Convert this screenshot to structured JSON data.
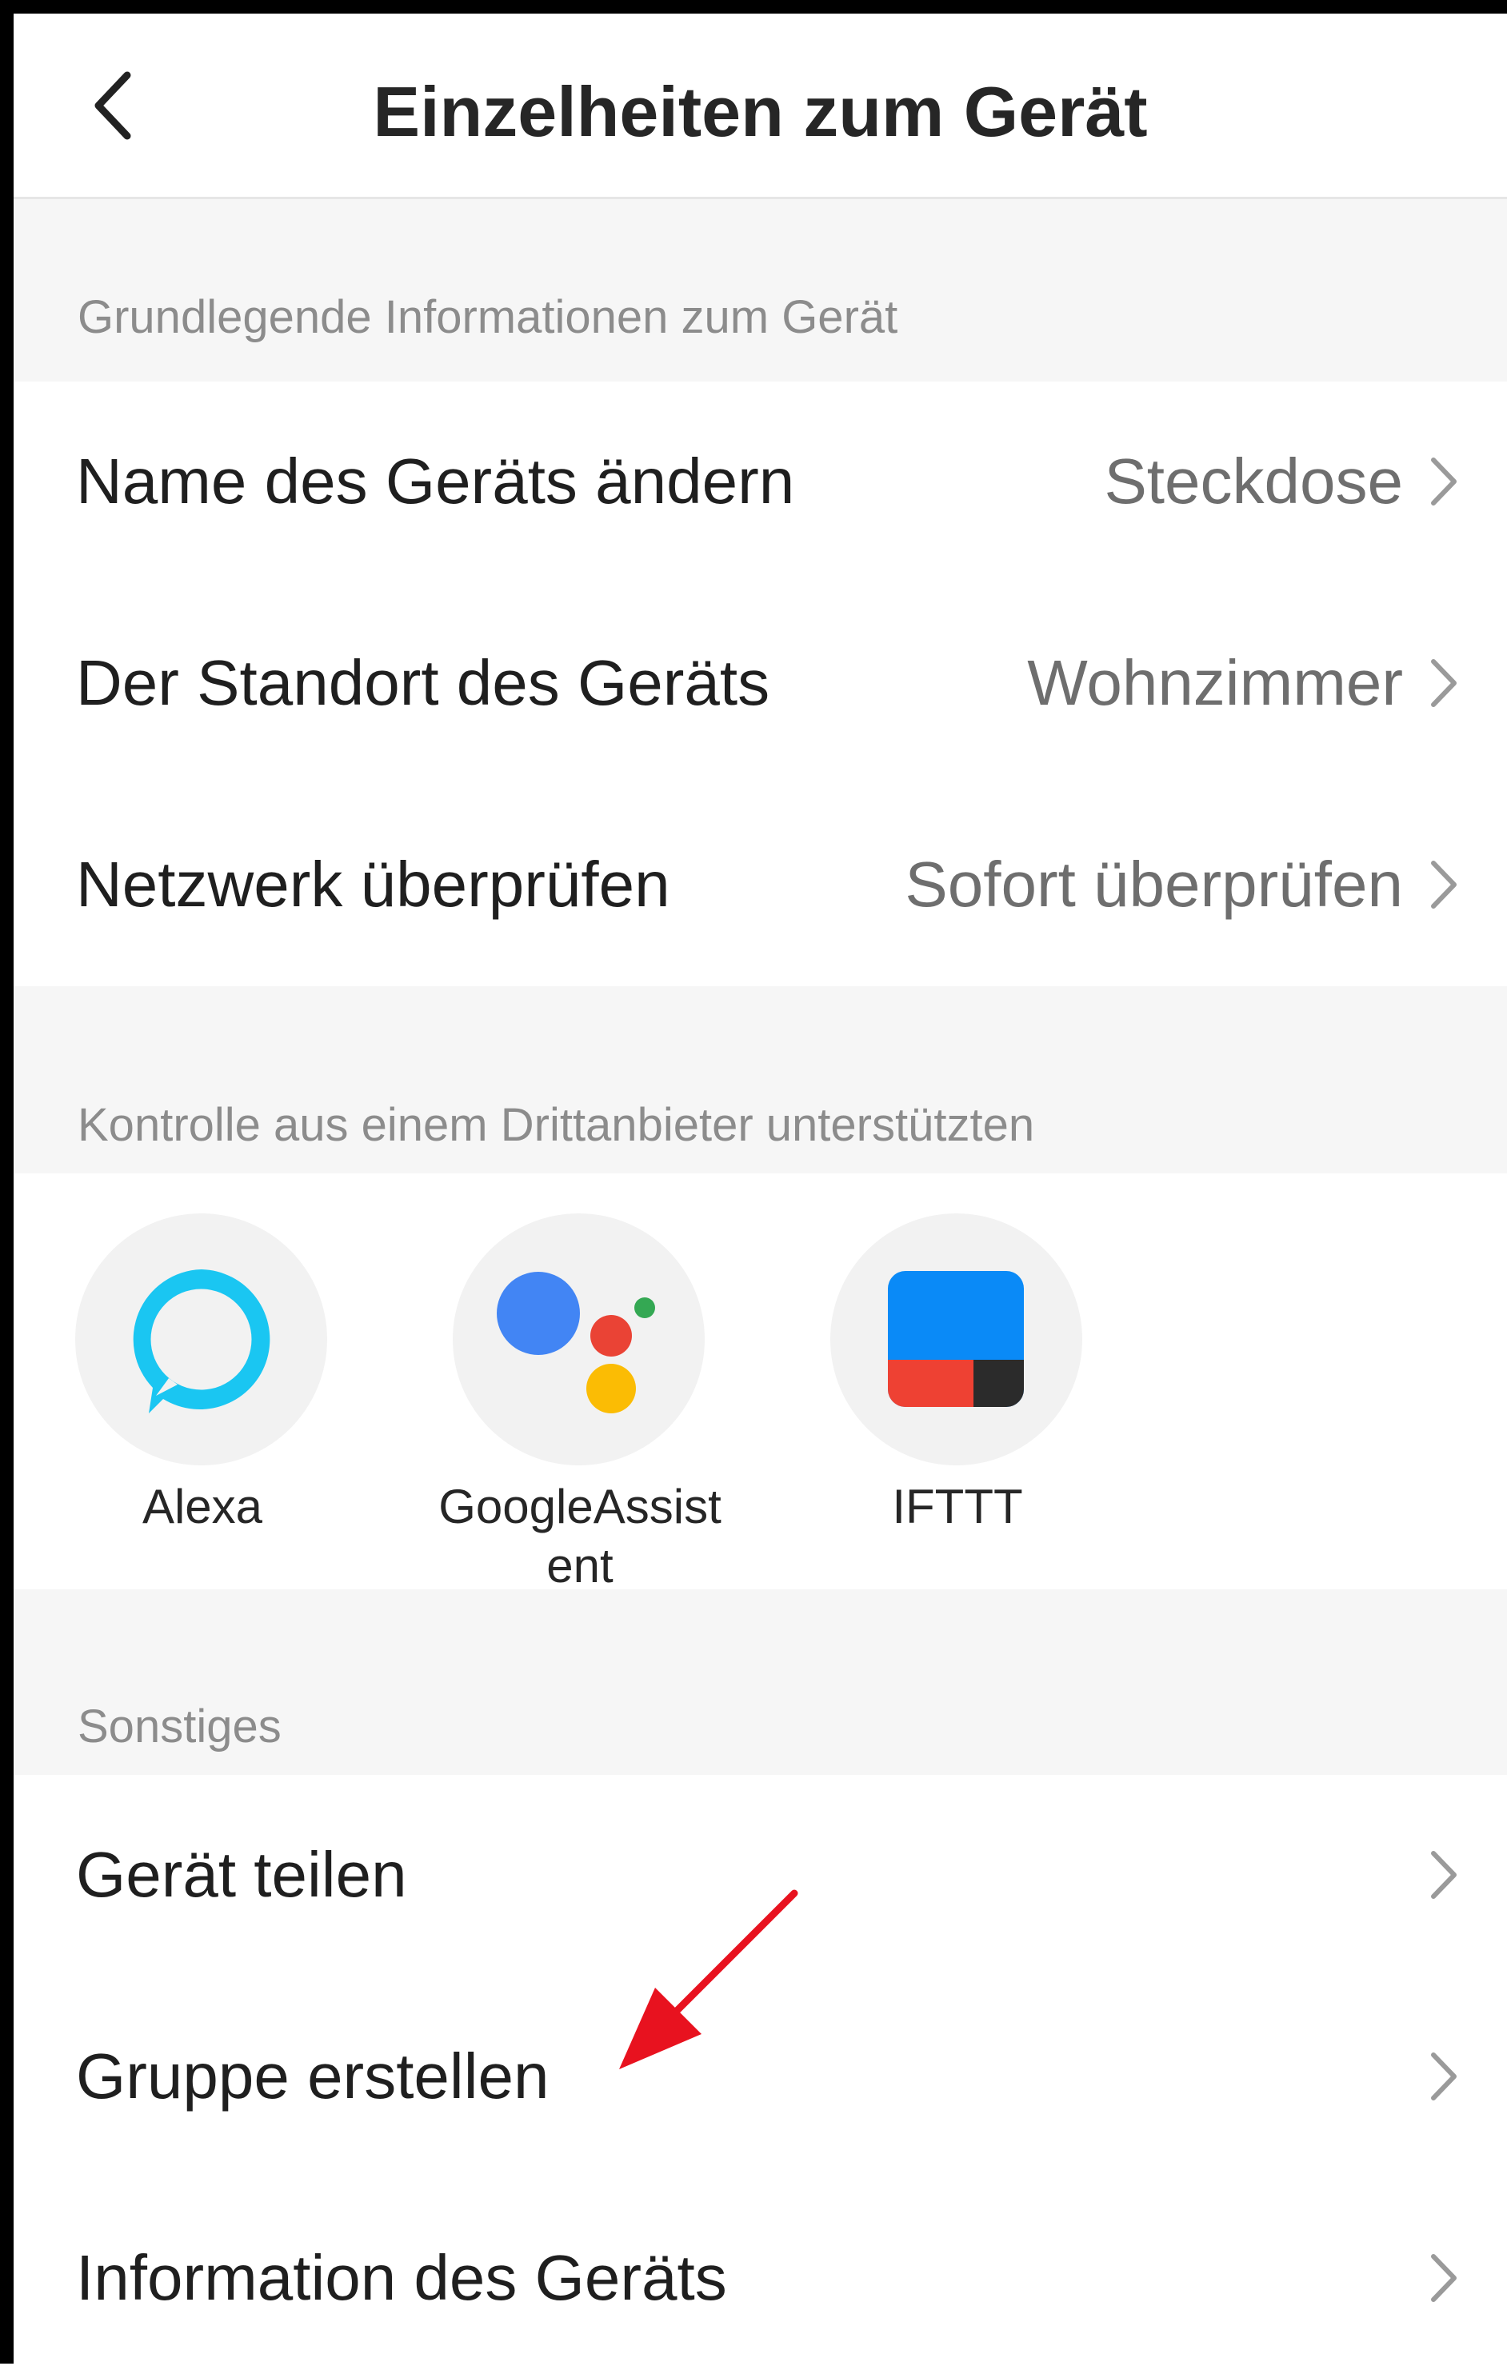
{
  "header": {
    "title": "Einzelheiten zum Gerät"
  },
  "basic_section": {
    "heading": "Grundlegende Informationen zum Gerät",
    "rows": [
      {
        "label": "Name des Geräts ändern",
        "value": "Steckdose"
      },
      {
        "label": "Der Standort des Geräts",
        "value": "Wohnzimmer"
      },
      {
        "label": "Netzwerk überprüfen",
        "value": "Sofort überprüfen"
      }
    ]
  },
  "third_party_section": {
    "heading": "Kontrolle aus einem Drittanbieter unterstützten",
    "services": [
      {
        "label": "Alexa",
        "icon": "alexa-icon"
      },
      {
        "label": "GoogleAssist\nent",
        "icon": "google-assistant-icon"
      },
      {
        "label": "IFTTT",
        "icon": "ifttt-icon"
      }
    ]
  },
  "other_section": {
    "heading": "Sonstiges",
    "rows": [
      {
        "label": "Gerät teilen"
      },
      {
        "label": "Gruppe erstellen"
      },
      {
        "label": "Information des Geräts"
      }
    ]
  },
  "icons": {
    "back": "back-chevron-icon",
    "row_arrow": "chevron-right-icon",
    "annotation": "red-arrow-annotation"
  },
  "colors": {
    "alexa": "#1ac6f2",
    "google_blue": "#4285f4",
    "google_red": "#ea4335",
    "google_yellow": "#fbbc04",
    "google_green": "#34a853",
    "ifttt_blue": "#0a8af7",
    "ifttt_red": "#ee4133",
    "ifttt_dark": "#2b2b2b",
    "annotation_red": "#e8121f"
  }
}
